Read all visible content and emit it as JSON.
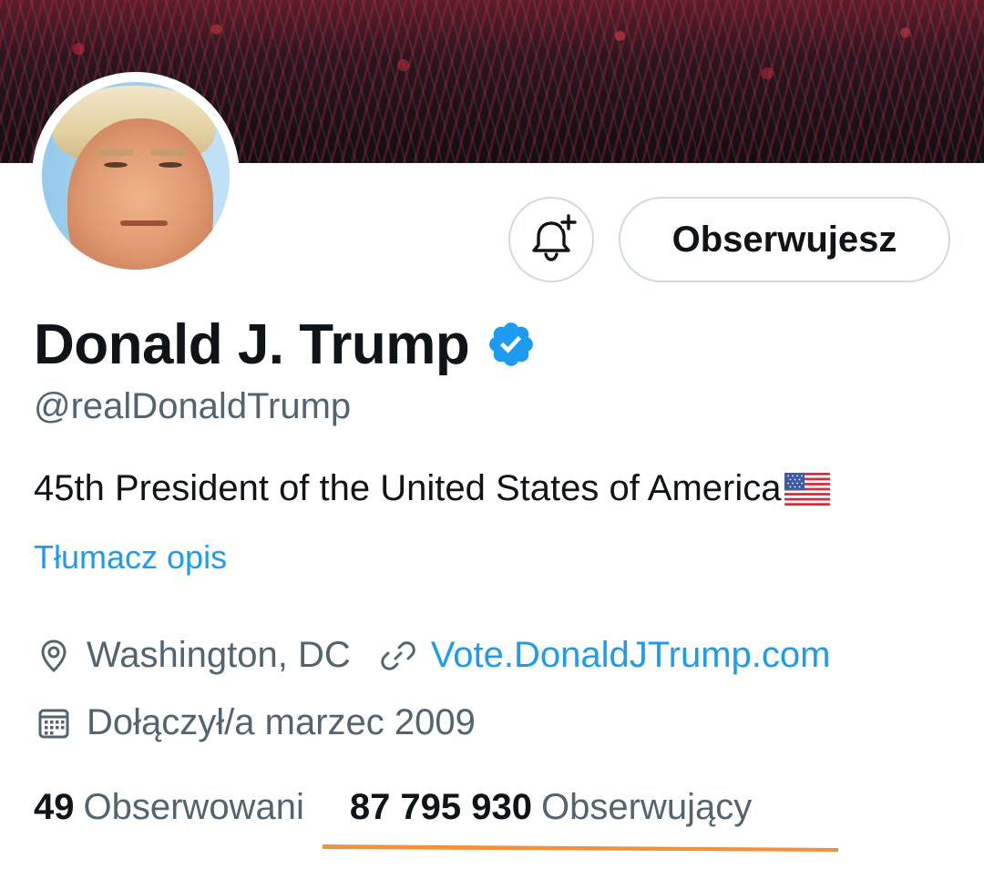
{
  "profile": {
    "name": "Donald J. Trump",
    "handle": "@realDonaldTrump",
    "bio": "45th President of the United States of America",
    "translate_label": "Tłumacz opis",
    "location": "Washington, DC",
    "website": "Vote.DonaldJTrump.com",
    "joined": "Dołączył/a marzec 2009"
  },
  "actions": {
    "follow_label": "Obserwujesz"
  },
  "stats": {
    "following_count": "49",
    "following_label": "Obserwowani",
    "followers_count": "87 795 930",
    "followers_label": "Obserwujący"
  },
  "icons": {
    "notification": "bell-plus-icon",
    "verified": "verified-badge-icon",
    "location": "location-pin-icon",
    "website": "link-icon",
    "joined": "calendar-icon",
    "flag": "us-flag-icon"
  },
  "colors": {
    "accent": "#1d9bf0",
    "text_primary": "#0f1419",
    "text_secondary": "#536471",
    "border": "#cfd9de",
    "highlight": "#f0913c"
  }
}
